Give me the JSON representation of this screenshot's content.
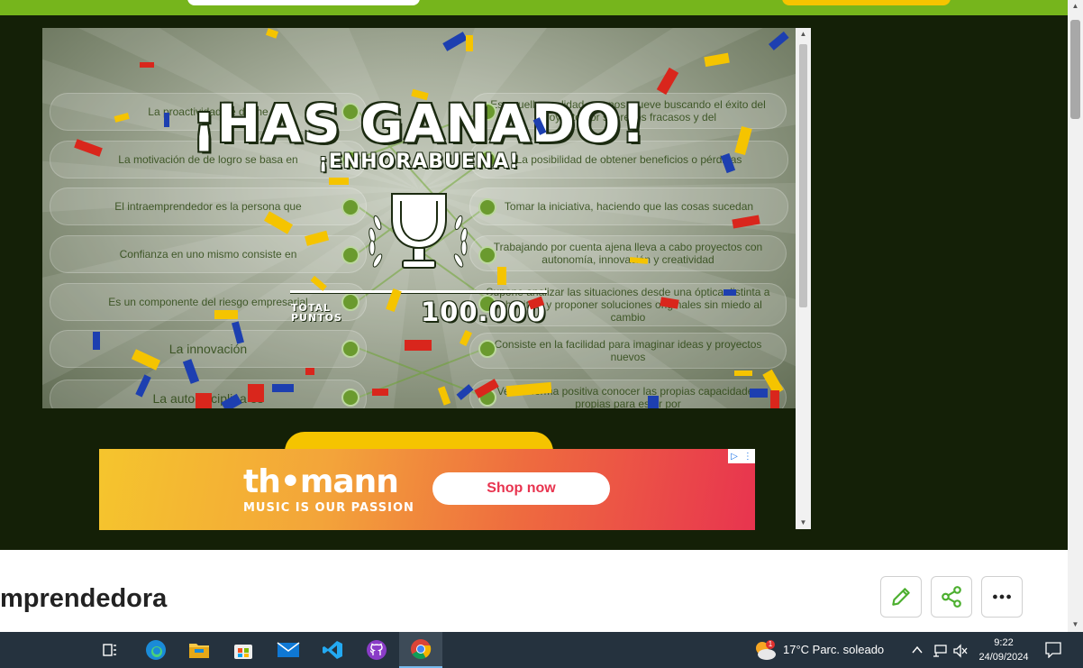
{
  "game": {
    "title": "¡HAS GANADO!",
    "subtitle": "¡ENHORABUENA!",
    "total_label": "TOTAL\nPUNTOS",
    "total_value": "100.000",
    "left_items": [
      "La proactividad se define",
      "La motivación de de logro se basa en",
      "El intraemprendedor es la persona que",
      "Confianza en uno mismo consiste en",
      "Es un componente del riesgo empresarial",
      "La innovación",
      "La autodisciplina es"
    ],
    "right_items": [
      "Es aquella cualidad que nos mueve buscando el éxito del proyecto por sobre los fracasos y del",
      "La posibilidad de obtener beneficios o pérdidas",
      "Tomar la iniciativa, haciendo que las cosas sucedan",
      "Trabajando por cuenta ajena lleva a cabo proyectos con autonomía, innovación y creatividad",
      "Supone analizar las situaciones desde una óptica distinta a la habitual y proponer soluciones originales sin miedo al cambio",
      "Consiste en la facilidad para imaginar ideas y proyectos nuevos",
      "Ver de forma positiva conocer las propias capacidades propias para estar por"
    ]
  },
  "ad": {
    "brand": "th•mann",
    "tagline": "MUSIC IS OUR PASSION",
    "cta": "Shop now"
  },
  "page": {
    "title": "mprendedora"
  },
  "taskbar": {
    "weather_text": "17°C  Parc. soleado",
    "weather_badge": "1",
    "time": "9:22",
    "date": "24/09/2024"
  },
  "colors": {
    "topbar": "#76b51c",
    "game_bg": "#142007",
    "accent_yellow": "#f5c400",
    "ad_red": "#e8344f",
    "green_icon": "#4caf2f"
  },
  "icons": [
    "pencil-icon",
    "share-icon",
    "more-icon",
    "trophy-icon",
    "task-view-icon",
    "edge-icon",
    "file-explorer-icon",
    "store-icon",
    "mail-icon",
    "vscode-icon",
    "github-icon",
    "chrome-icon",
    "weather-icon",
    "chevron-up-icon",
    "network-icon",
    "mute-icon",
    "notification-icon"
  ]
}
